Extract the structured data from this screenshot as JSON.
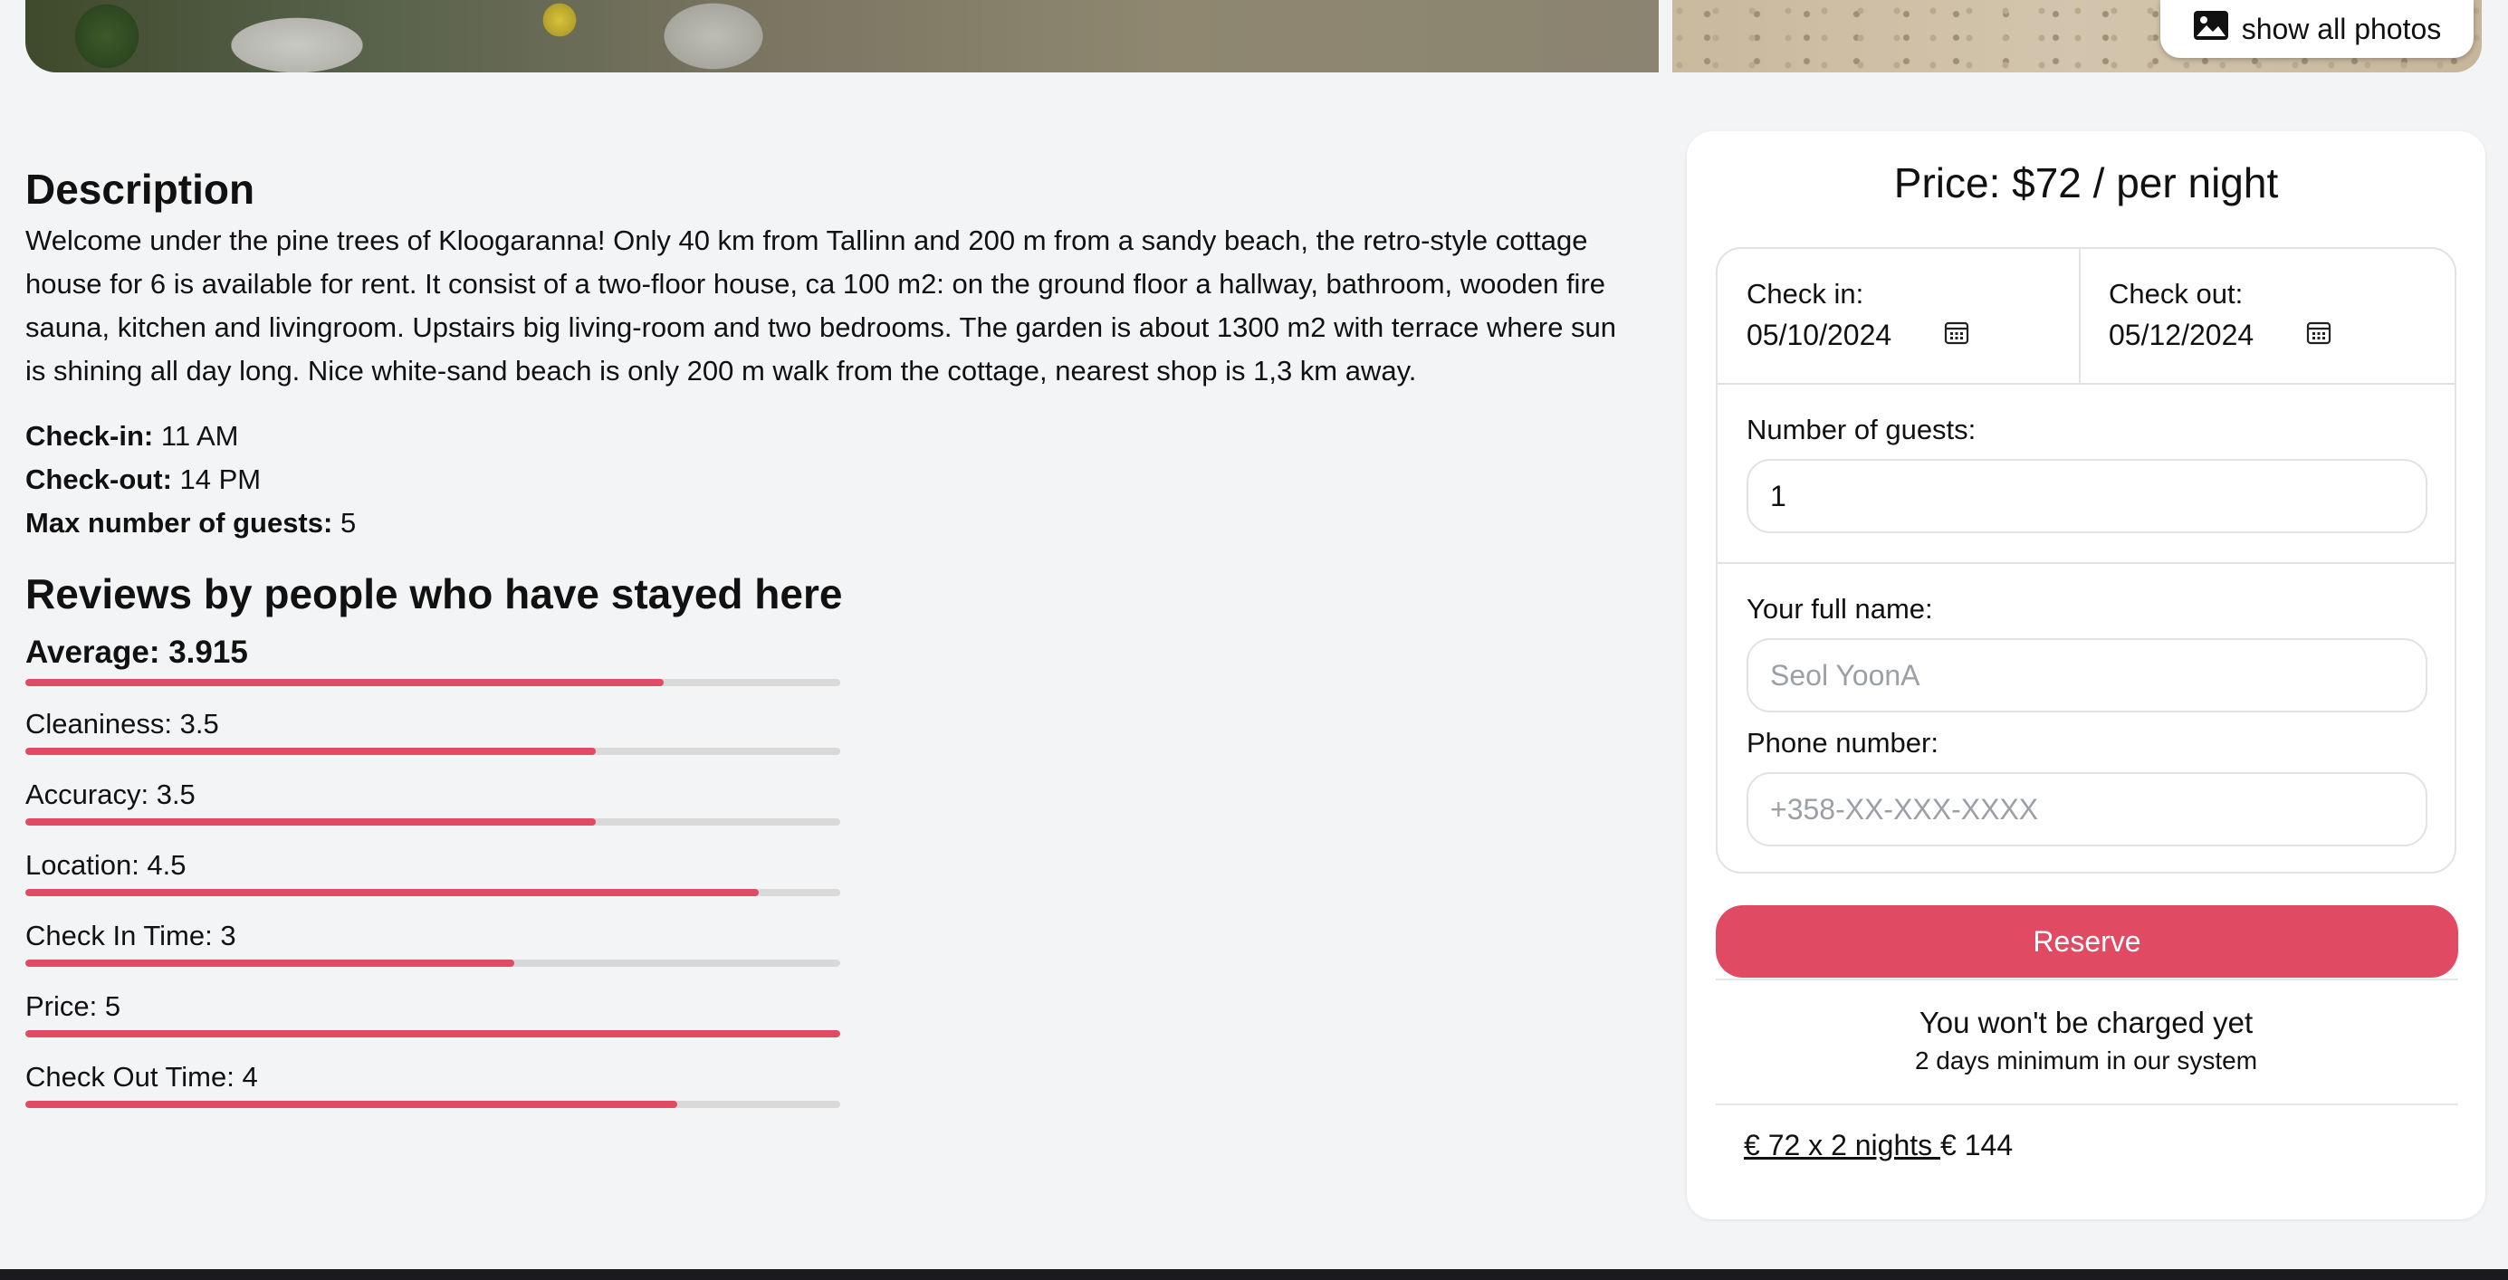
{
  "gallery": {
    "show_all_label": "show all photos",
    "icon": "image-icon"
  },
  "description": {
    "title": "Description",
    "text": "Welcome under the pine trees of Kloogaranna! Only 40 km from Tallinn and 200 m from a sandy beach, the retro-style cottage house for 6 is available for rent. It consist of a two-floor house, ca 100 m2: on the ground floor a hallway, bathroom, wooden fire sauna, kitchen and livingroom. Upstairs big living-room and two bedrooms. The garden is about 1300 m2 with terrace where sun is shining all day long. Nice white-sand beach is only 200 m walk from the cottage, nearest shop is 1,3 km away."
  },
  "facts": {
    "checkin_label": "Check-in:",
    "checkin_value": "11 AM",
    "checkout_label": "Check-out:",
    "checkout_value": "14 PM",
    "max_guests_label": "Max number of guests:",
    "max_guests_value": "5"
  },
  "reviews": {
    "title": "Reviews by people who have stayed here",
    "scale_max": 5,
    "average": {
      "label": "Average: 3.915",
      "value": 3.915
    },
    "items": [
      {
        "label": "Cleaniness: 3.5",
        "value": 3.5
      },
      {
        "label": "Accuracy: 3.5",
        "value": 3.5
      },
      {
        "label": "Location: 4.5",
        "value": 4.5
      },
      {
        "label": "Check In Time: 3",
        "value": 3
      },
      {
        "label": "Price: 5",
        "value": 5
      },
      {
        "label": "Check Out Time: 4",
        "value": 4
      }
    ]
  },
  "booking": {
    "price_title": "Price: $72 / per night",
    "checkin_label": "Check in:",
    "checkin_value": "05/10/2024",
    "checkout_label": "Check out:",
    "checkout_value": "05/12/2024",
    "guests_label": "Number of guests:",
    "guests_value": "1",
    "name_label": "Your full name:",
    "name_placeholder": "Seol YoonA",
    "phone_label": "Phone number:",
    "phone_placeholder": "+358-XX-XXX-XXXX",
    "reserve_label": "Reserve",
    "charged_note": "You won't be charged yet",
    "minimum_note": "2 days minimum in our system",
    "nights_link": "€ 72 x 2 nights ",
    "total": "€ 144",
    "accent_color": "#e04b63"
  }
}
